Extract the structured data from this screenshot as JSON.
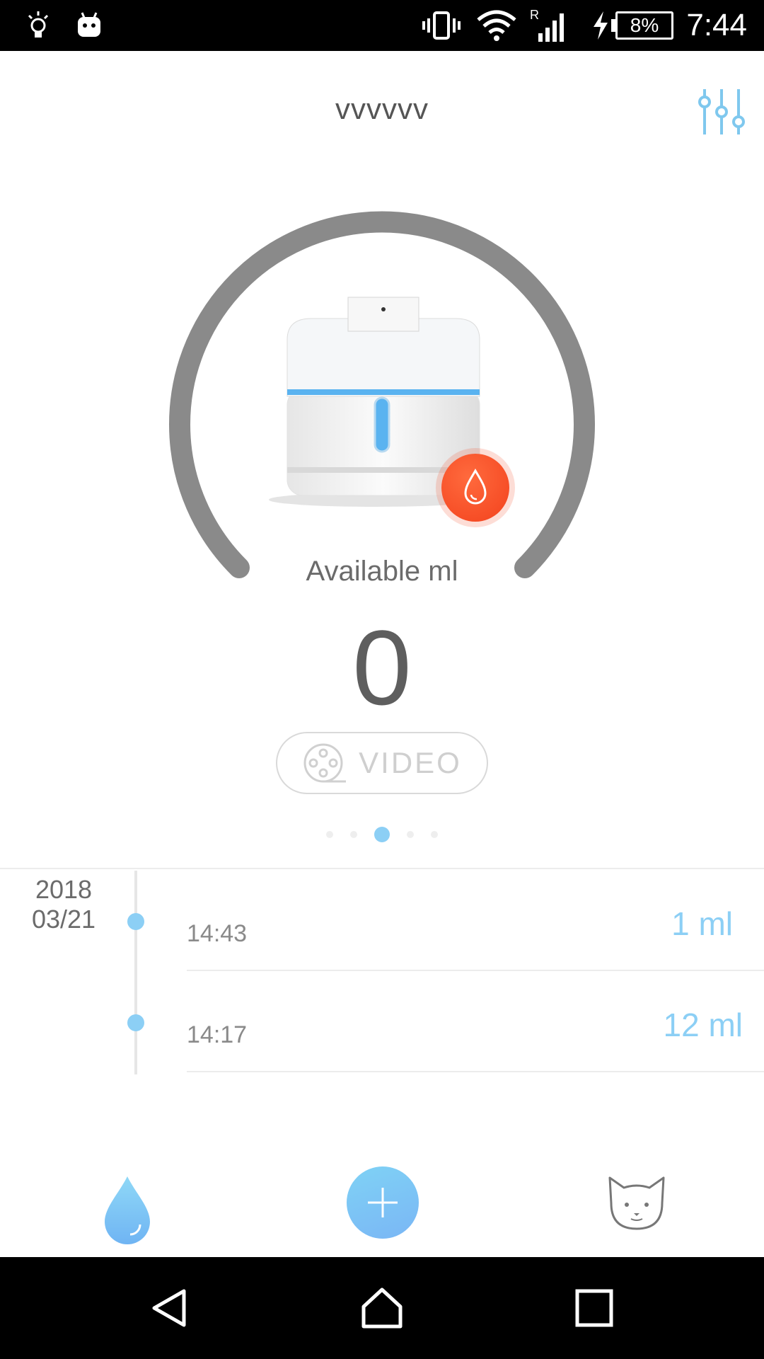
{
  "status_bar": {
    "time": "7:44",
    "battery": "8%",
    "icons": [
      "bulb-icon",
      "android-icon",
      "vibrate-icon",
      "wifi-icon",
      "signal-icon",
      "charging-icon",
      "battery-icon"
    ]
  },
  "header": {
    "title": "vvvvvv",
    "settings_icon": "sliders-icon"
  },
  "gauge": {
    "label": "Available ml",
    "value": "0",
    "level_fraction": 0,
    "colors": {
      "track": "#8a8a8a",
      "alert": "#f3421d",
      "accent": "#8ccff5"
    }
  },
  "video": {
    "label": "VIDEO",
    "icon": "film-reel-icon"
  },
  "pager": {
    "count": 5,
    "active_index": 2
  },
  "timeline": {
    "date_year": "2018",
    "date_day": "03/21",
    "entries": [
      {
        "time": "14:43",
        "amount": "1 ml"
      },
      {
        "time": "14:17",
        "amount": "12 ml"
      }
    ]
  },
  "tab_bar": {
    "items": [
      "water-drop-icon",
      "add-icon",
      "cat-icon"
    ]
  },
  "nav_bar": {
    "items": [
      "back-icon",
      "home-icon",
      "recents-icon"
    ]
  }
}
